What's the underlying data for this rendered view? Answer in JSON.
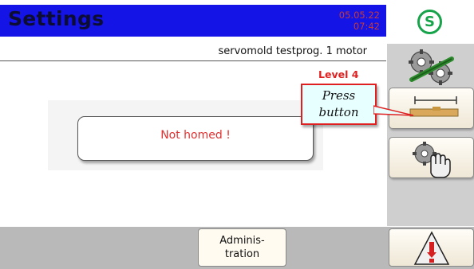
{
  "header": {
    "title": "Settings",
    "date": "05.05.22",
    "time": "07:42",
    "logo_icon": "s-logo-icon",
    "colors": {
      "titlebar": "#1414e6",
      "logo": "#17a34a"
    }
  },
  "program": {
    "name": "servomold testprog. 1 motor"
  },
  "message": {
    "text": "Not homed !",
    "color": "#e03030"
  },
  "callout": {
    "level": "Level 4",
    "line1": "Press",
    "line2": "button",
    "border_color": "#e02020"
  },
  "sidebar": {
    "buttons": [
      {
        "icon": "gears-with-wrench-icon"
      },
      {
        "icon": "ruler-measurement-icon"
      },
      {
        "icon": "gear-hand-icon"
      }
    ]
  },
  "footer": {
    "admin_line1": "Adminis-",
    "admin_line2": "tration",
    "alarm_icon": "warning-triangle-icon"
  }
}
